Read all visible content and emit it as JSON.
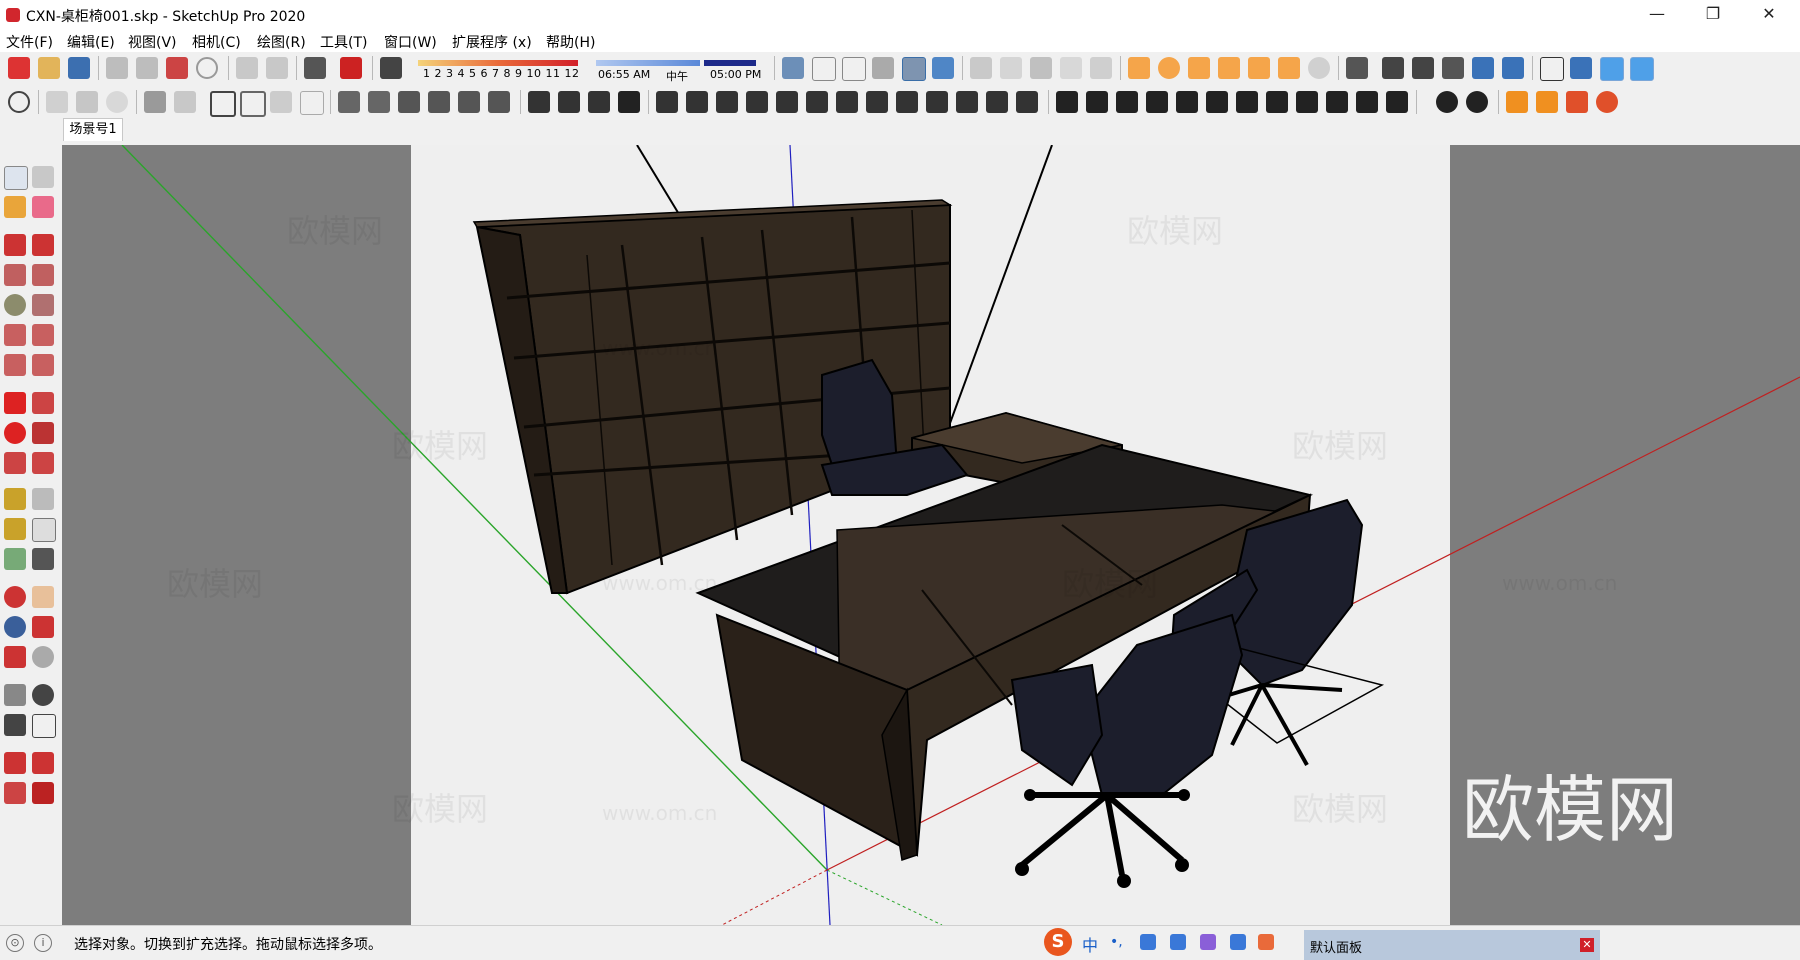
{
  "window": {
    "title": "CXN-桌柜椅001.skp - SketchUp Pro 2020",
    "minimize_glyph": "—",
    "restore_glyph": "❐",
    "close_glyph": "✕"
  },
  "menu": [
    {
      "label": "文件(F)"
    },
    {
      "label": "编辑(E)"
    },
    {
      "label": "视图(V)"
    },
    {
      "label": "相机(C)"
    },
    {
      "label": "绘图(R)"
    },
    {
      "label": "工具(T)"
    },
    {
      "label": "窗口(W)"
    },
    {
      "label": "扩展程序 (x)"
    },
    {
      "label": "帮助(H)"
    }
  ],
  "shadow_toolbar": {
    "month_numbers": "1 2 3 4 5 6 7 8 9 10 11 12",
    "time_start": "06:55 AM",
    "time_noon": "中午",
    "time_end": "05:00 PM"
  },
  "scene_tab": {
    "label": "场景号1"
  },
  "watermarks": {
    "brand": "欧模网",
    "domain": "www.om.cn"
  },
  "status": {
    "text": "选择对象。切换到扩充选择。拖动鼠标选择多项。",
    "geo_icon": "⊙",
    "info_icon": "i"
  },
  "ime": {
    "logo": "S",
    "lang": "中",
    "punct": "•,"
  },
  "default_panel": {
    "title": "默认面板",
    "close": "✕"
  },
  "colors": {
    "axis_green": "#2aa52a",
    "axis_red": "#c02020",
    "axis_blue": "#2020c0",
    "wood_dark": "#3a2f26",
    "chair_navy": "#1c1e2c",
    "view_bg": "#efefef",
    "outside_bg": "#7d7d7d"
  }
}
